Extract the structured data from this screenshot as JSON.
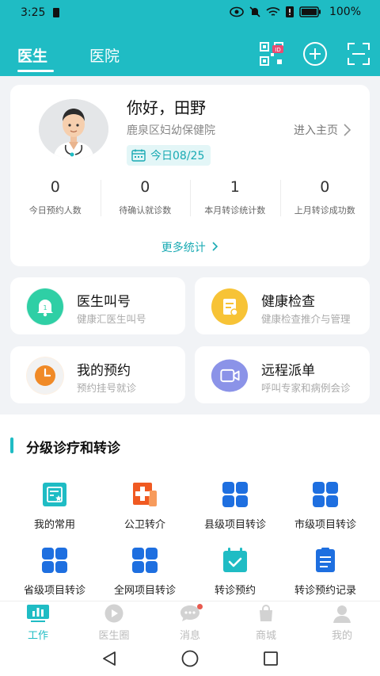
{
  "status_bar": {
    "time": "3:25",
    "battery": "100%"
  },
  "header": {
    "tabs": [
      {
        "label": "医生"
      },
      {
        "label": "医院"
      }
    ]
  },
  "profile": {
    "greeting": "你好，田野",
    "hospital": "鹿泉区妇幼保健院",
    "homepage_link": "进入主页",
    "date_badge": "今日08/25",
    "stats": [
      {
        "value": "0",
        "label": "今日预约人数"
      },
      {
        "value": "0",
        "label": "待确认就诊数"
      },
      {
        "value": "1",
        "label": "本月转诊统计数"
      },
      {
        "value": "0",
        "label": "上月转诊成功数"
      }
    ],
    "more_stats": "更多统计"
  },
  "features": [
    {
      "title": "医生叫号",
      "subtitle": "健康汇医生叫号",
      "icon": "bell-icon",
      "color": "#2fcfa5"
    },
    {
      "title": "健康检查",
      "subtitle": "健康检查推介与管理",
      "icon": "report-icon",
      "color": "#f7c336"
    },
    {
      "title": "我的预约",
      "subtitle": "预约挂号就诊",
      "icon": "clock-icon",
      "color": "#f08a27"
    },
    {
      "title": "远程派单",
      "subtitle": "呼叫专家和病例会诊",
      "icon": "video-icon",
      "color": "#8b93e8"
    }
  ],
  "section": {
    "title": "分级诊疗和转诊",
    "items": [
      {
        "label": "我的常用",
        "icon": "favorite-doc-icon"
      },
      {
        "label": "公卫转介",
        "icon": "medical-plus-icon"
      },
      {
        "label": "县级项目转诊",
        "icon": "grid-icon"
      },
      {
        "label": "市级项目转诊",
        "icon": "grid-icon"
      },
      {
        "label": "省级项目转诊",
        "icon": "grid-icon"
      },
      {
        "label": "全网项目转诊",
        "icon": "grid-icon"
      },
      {
        "label": "转诊预约",
        "icon": "calendar-check-icon"
      },
      {
        "label": "转诊预约记录",
        "icon": "list-doc-icon"
      }
    ]
  },
  "bottom_nav": [
    {
      "label": "工作",
      "icon": "chart-icon"
    },
    {
      "label": "医生圈",
      "icon": "circle-play-icon"
    },
    {
      "label": "消息",
      "icon": "chat-icon"
    },
    {
      "label": "商城",
      "icon": "bag-icon"
    },
    {
      "label": "我的",
      "icon": "person-icon"
    }
  ],
  "colors": {
    "accent": "#1fbcc4",
    "blue": "#1e6fe0"
  }
}
